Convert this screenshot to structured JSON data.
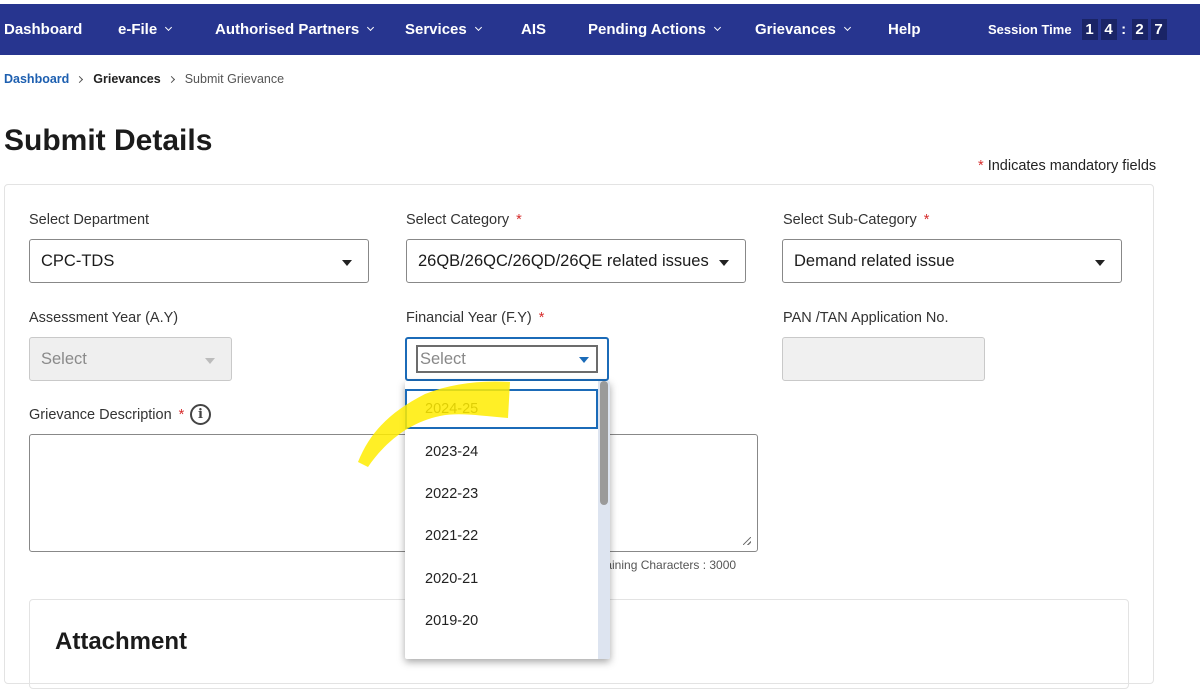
{
  "nav": {
    "items": [
      {
        "label": "Dashboard",
        "dropdown": false
      },
      {
        "label": "e-File",
        "dropdown": true
      },
      {
        "label": "Authorised Partners",
        "dropdown": true
      },
      {
        "label": "Services",
        "dropdown": true
      },
      {
        "label": "AIS",
        "dropdown": false
      },
      {
        "label": "Pending Actions",
        "dropdown": true
      },
      {
        "label": "Grievances",
        "dropdown": true
      },
      {
        "label": "Help",
        "dropdown": false
      }
    ],
    "session_label": "Session Time",
    "session_digits": [
      "1",
      "4",
      "2",
      "7"
    ],
    "session_separator": ":",
    "bg_color": "#27358f"
  },
  "breadcrumb": {
    "home": "Dashboard",
    "section": "Grievances",
    "current": "Submit Grievance"
  },
  "page": {
    "title": "Submit Details",
    "mandatory_star": "*",
    "mandatory_note": "Indicates mandatory fields"
  },
  "form": {
    "required_marker": "*",
    "department": {
      "label": "Select Department",
      "value": "CPC-TDS"
    },
    "category": {
      "label": "Select Category",
      "value": "26QB/26QC/26QD/26QE related issues"
    },
    "subcategory": {
      "label": "Select Sub-Category",
      "value": "Demand related issue"
    },
    "assessment_year": {
      "label": "Assessment Year (A.Y)",
      "placeholder": "Select"
    },
    "financial_year": {
      "label": "Financial Year (F.Y)",
      "placeholder": "Select"
    },
    "pan_tan": {
      "label": "PAN /TAN Application No.",
      "value": ""
    },
    "description": {
      "label": "Grievance Description",
      "info_icon": "i",
      "remaining": "Remaining Characters : 3000"
    },
    "accent_color": "#1b6bb8"
  },
  "attachment": {
    "title": "Attachment"
  },
  "fy_dropdown": {
    "options": [
      "2024-25",
      "2023-24",
      "2022-23",
      "2021-22",
      "2020-21",
      "2019-20"
    ],
    "highlighted": "2024-25"
  }
}
